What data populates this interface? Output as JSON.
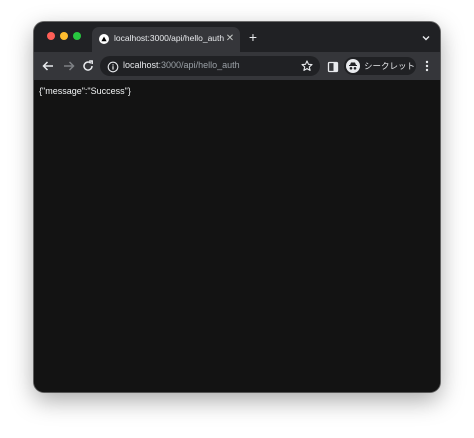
{
  "tab": {
    "title": "localhost:3000/api/hello_auth",
    "close_label": "✕"
  },
  "tabstrip": {
    "new_tab_label": "+"
  },
  "omnibox": {
    "host": "localhost",
    "path": ":3000/api/hello_auth"
  },
  "profile": {
    "label": "シークレット"
  },
  "page": {
    "body_text": "{\"message\":\"Success\"}"
  },
  "colors": {
    "close": "#ff5f57",
    "minimize": "#febc2e",
    "maximize": "#28c840",
    "page_background": "#131313",
    "toolbar": "#35363a"
  }
}
